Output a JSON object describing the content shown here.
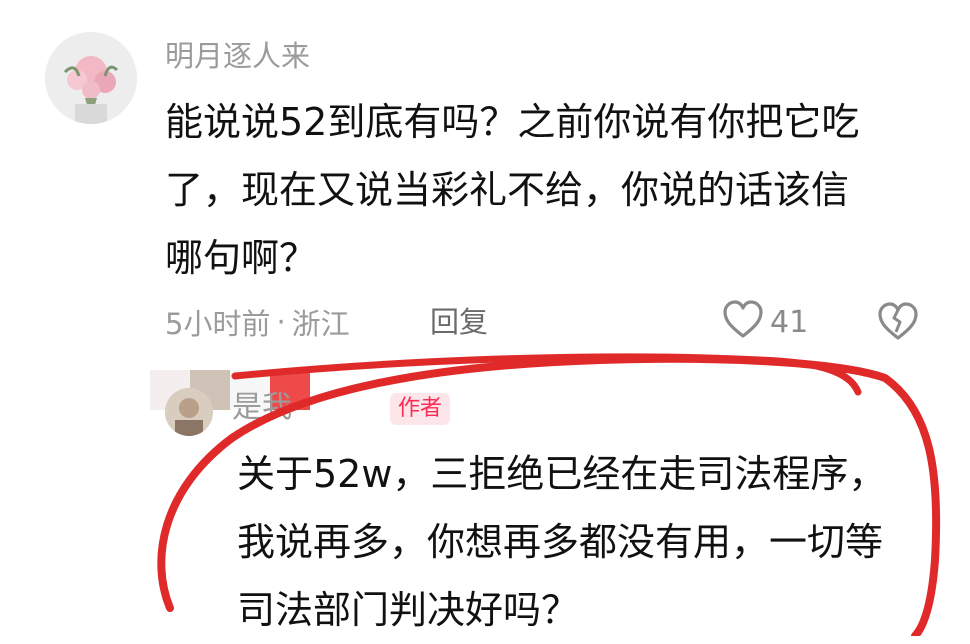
{
  "comment": {
    "username": "明月逐人来",
    "text_lines": [
      "能说说52到底有吗？之前你说有你把它吃",
      "了，现在又说当彩礼不给，你说的话该信",
      "哪句啊？"
    ],
    "time": "5小时前",
    "separator": "·",
    "location": "浙江",
    "reply_label": "回复",
    "like_count": "41",
    "icons": {
      "like": "heart-outline-icon",
      "dislike": "broken-heart-icon"
    }
  },
  "reply": {
    "username": "是我",
    "author_tag": "作者",
    "text_lines": [
      "关于52w，三拒绝已经在走司法程序，",
      "我说再多，你想再多都没有用，一切等",
      "司法部门判决好吗？"
    ]
  },
  "colors": {
    "author_tag_text": "#fe2c55",
    "author_tag_bg": "#fde6ea",
    "annotation_loop": "#e02a2a",
    "meta_text": "#9b9b9b"
  }
}
